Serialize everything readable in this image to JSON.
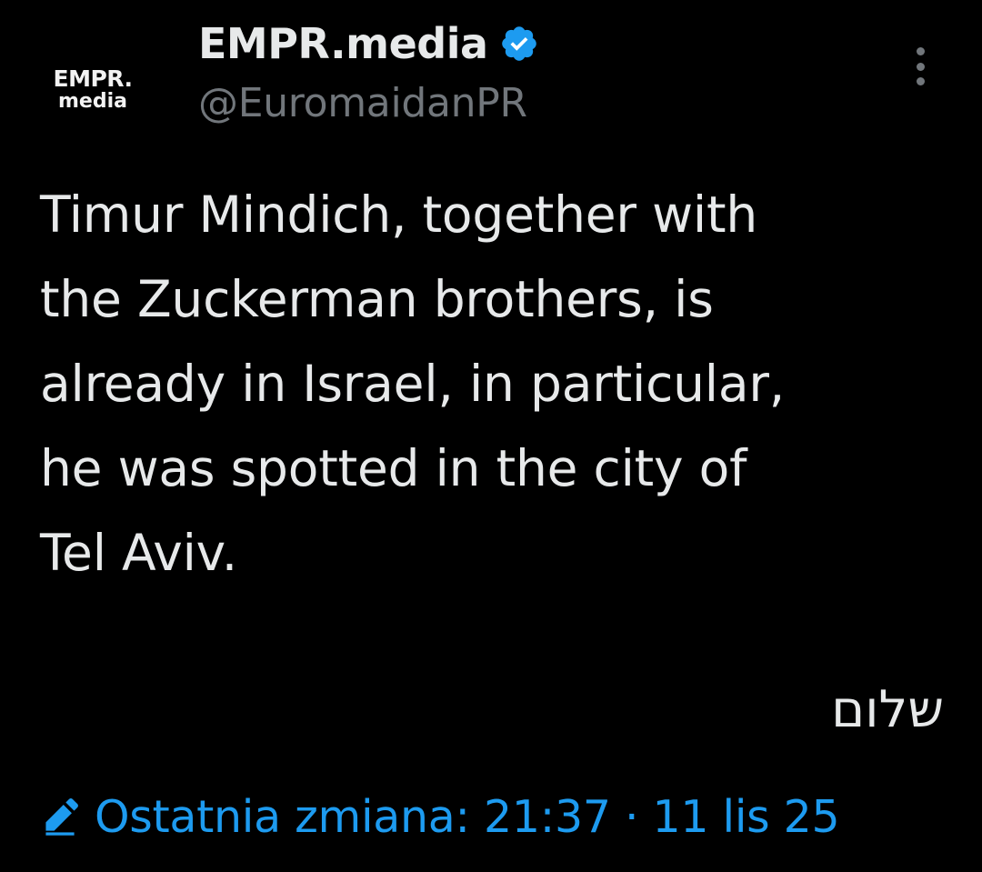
{
  "author": {
    "avatar": {
      "line1": "EMPR.",
      "line2": "media"
    },
    "display_name": "EMPR.media",
    "handle": "@EuromaidanPR",
    "verified_icon": "verified-badge-icon",
    "verified_color": "#1d9bf0"
  },
  "menu": {
    "icon": "more-vertical-icon"
  },
  "tweet": {
    "text": "Timur Mindich, together with\nthe Zuckerman brothers, is\nalready in Israel, in particular,\nhe was spotted in the city of\nTel Aviv.",
    "hebrew": "שלום"
  },
  "edit_info": {
    "icon": "pencil-icon",
    "label": "Ostatnia zmiana: 21:37 · 11 lis 25",
    "color": "#1d9bf0"
  }
}
